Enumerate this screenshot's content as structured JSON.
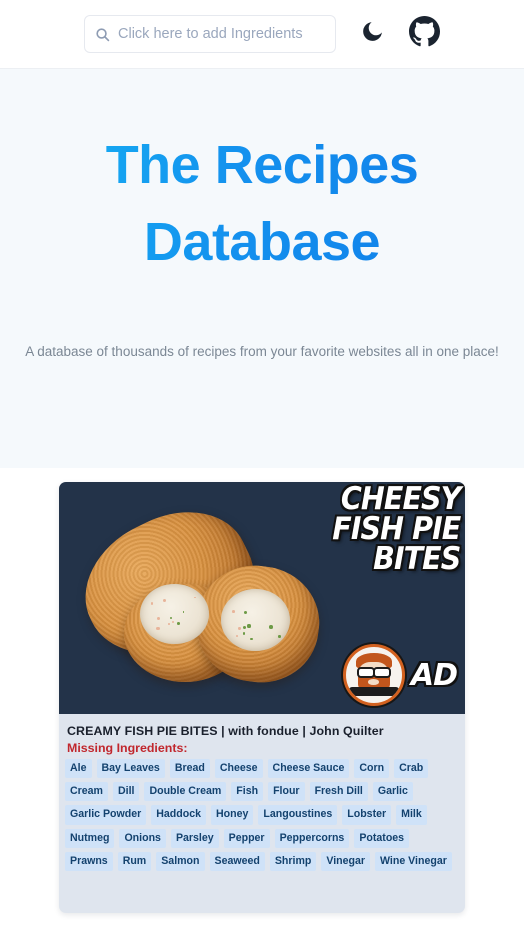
{
  "header": {
    "search": {
      "placeholder": "Click here to add Ingredients",
      "value": "",
      "icon": "search-icon"
    },
    "dark_mode_icon": "moon-icon",
    "github_icon": "github-icon"
  },
  "hero": {
    "title_line1": "The Recipes",
    "title_line2": "Database",
    "subtitle": "A database of thousands of recipes from your favorite websites all in one place!",
    "title_gradient_from": "#16b6f4",
    "title_gradient_to": "#0f7ae8",
    "background": "#f5f9fc"
  },
  "recipe_card": {
    "thumbnail": {
      "overlay_line1": "CHEESY",
      "overlay_line2": "FISH PIE",
      "overlay_line3": "BITES",
      "ad_badge": "AD",
      "logo_name": "chef-logo"
    },
    "title": "CREAMY FISH PIE BITES | with fondue | John Quilter",
    "missing_label": "Missing Ingredients:",
    "missing_ingredients": [
      "Ale",
      "Bay Leaves",
      "Bread",
      "Cheese",
      "Cheese Sauce",
      "Corn",
      "Crab",
      "Cream",
      "Dill",
      "Double Cream",
      "Fish",
      "Flour",
      "Fresh Dill",
      "Garlic",
      "Garlic Powder",
      "Haddock",
      "Honey",
      "Langoustines",
      "Lobster",
      "Milk",
      "Nutmeg",
      "Onions",
      "Parsley",
      "Pepper",
      "Peppercorns",
      "Potatoes",
      "Prawns",
      "Rum",
      "Salmon",
      "Seaweed",
      "Shrimp",
      "Vinegar",
      "Wine Vinegar"
    ],
    "tag_background": "#cfe2f8",
    "tag_color": "#14426e",
    "card_background": "#dfe5ee",
    "missing_label_color": "#c1272d"
  }
}
